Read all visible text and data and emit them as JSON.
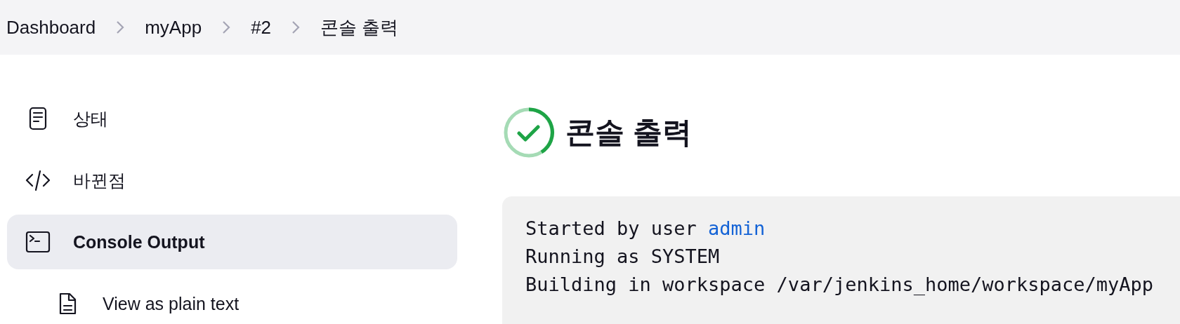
{
  "breadcrumbs": [
    {
      "label": "Dashboard"
    },
    {
      "label": "myApp"
    },
    {
      "label": "#2"
    },
    {
      "label": "콘솔 출력"
    }
  ],
  "sidebar": {
    "items": [
      {
        "label": "상태",
        "kind": "document",
        "selected": false
      },
      {
        "label": "바뀐점",
        "kind": "code",
        "selected": false
      },
      {
        "label": "Console Output",
        "kind": "terminal",
        "selected": true,
        "children": [
          {
            "label": "View as plain text",
            "kind": "file",
            "selected": false
          }
        ]
      }
    ]
  },
  "header": {
    "title": "콘솔 출력",
    "kind": "success"
  },
  "console": {
    "lines": [
      [
        {
          "text": "Started by user "
        },
        {
          "text": "admin",
          "kind": "link"
        }
      ],
      [
        {
          "text": "Running as SYSTEM"
        }
      ],
      [
        {
          "text": "Building in workspace /var/jenkins_home/workspace/myApp"
        }
      ]
    ]
  }
}
